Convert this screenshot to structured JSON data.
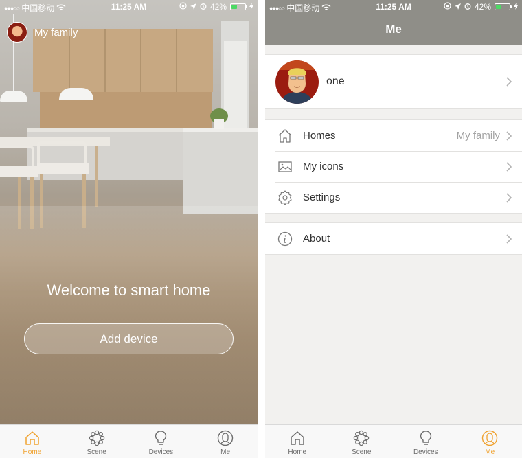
{
  "status_left": {
    "carrier": "中国移动",
    "time": "11:25 AM",
    "battery": "42%",
    "battery_level": 0.42
  },
  "status_right": {
    "carrier": "中国移动",
    "time": "11:25 AM",
    "battery": "42%",
    "battery_level": 0.42
  },
  "home": {
    "family_name": "My family",
    "welcome": "Welcome to smart home",
    "add_device": "Add device"
  },
  "me": {
    "title": "Me",
    "username": "one",
    "rows": [
      {
        "label": "Homes",
        "value": "My family",
        "icon": "house-icon"
      },
      {
        "label": "My icons",
        "value": "",
        "icon": "image-icon"
      },
      {
        "label": "Settings",
        "value": "",
        "icon": "gear-icon"
      },
      {
        "label": "About",
        "value": "",
        "icon": "info-icon"
      }
    ]
  },
  "tabs": [
    {
      "label": "Home",
      "icon": "home-icon"
    },
    {
      "label": "Scene",
      "icon": "scene-icon"
    },
    {
      "label": "Devices",
      "icon": "bulb-icon"
    },
    {
      "label": "Me",
      "icon": "person-icon"
    }
  ],
  "colors": {
    "accent": "#f0a22f",
    "navbar": "#8f8e88",
    "battery": "#4cd964"
  }
}
